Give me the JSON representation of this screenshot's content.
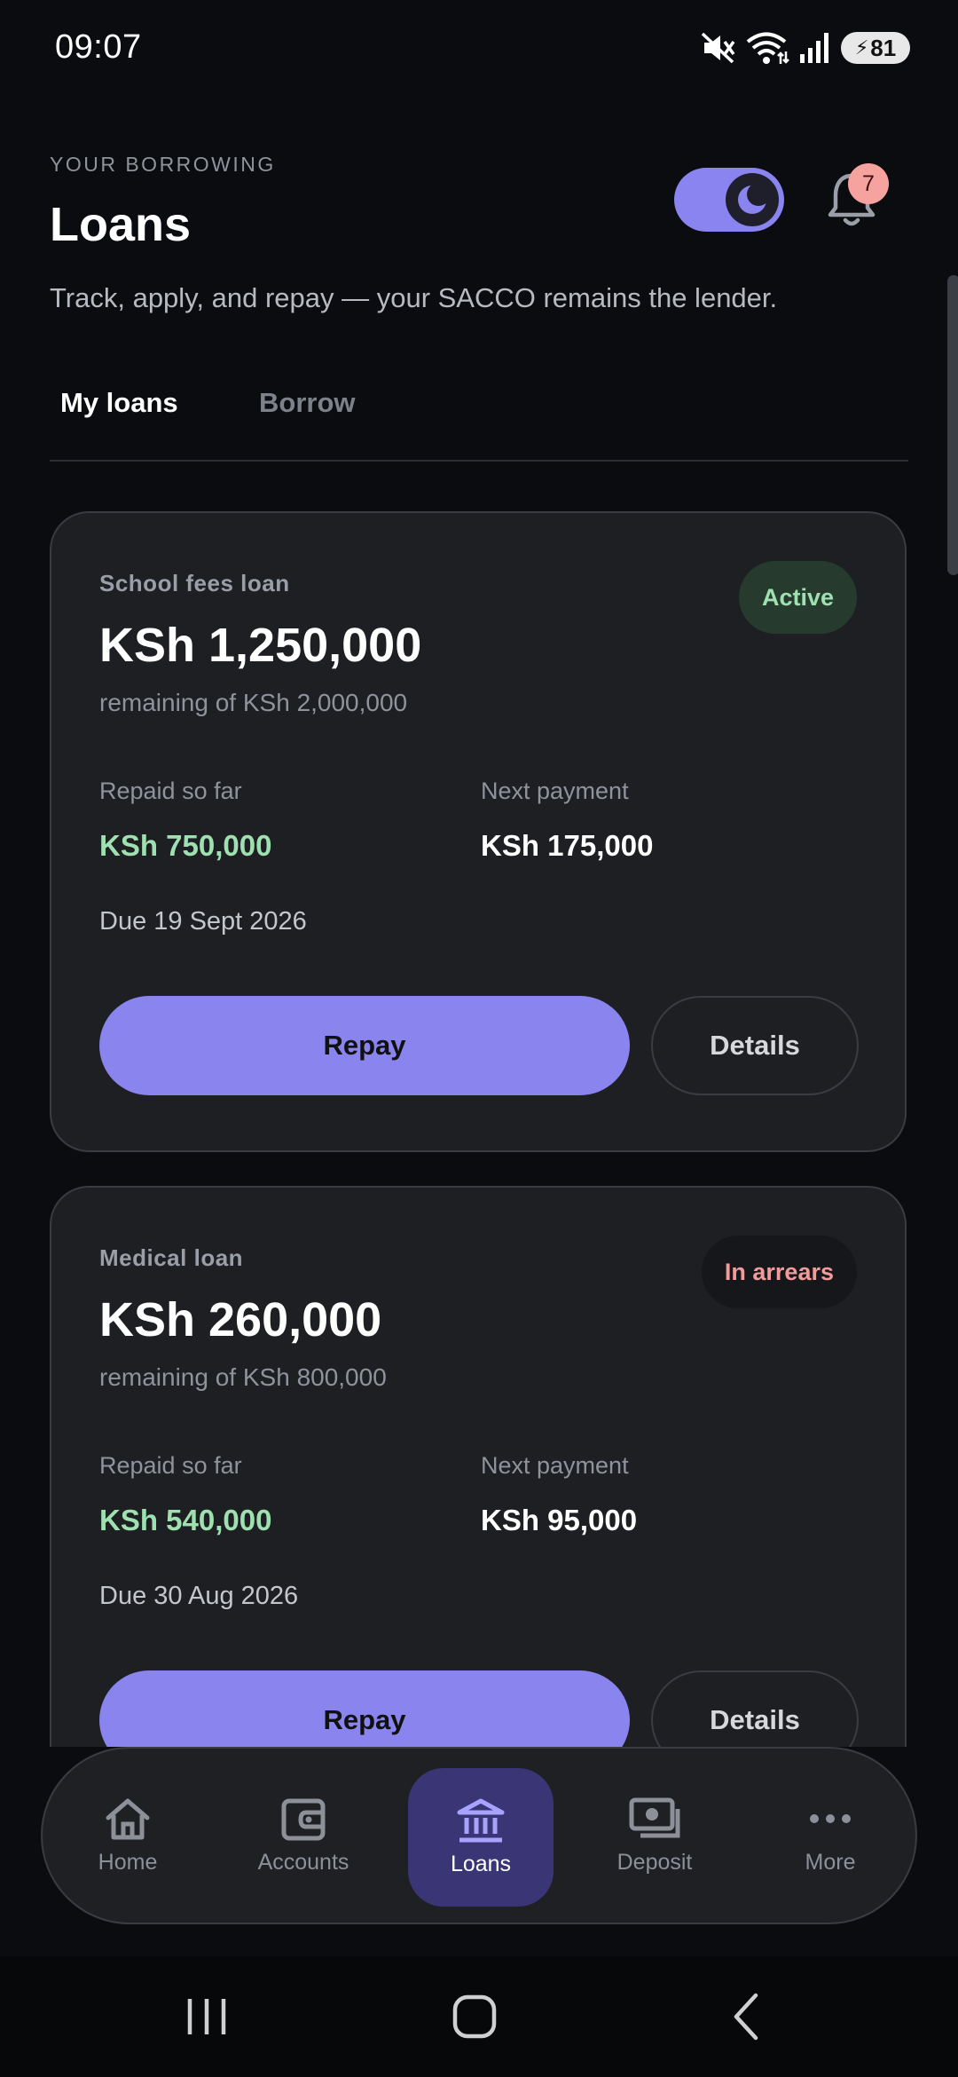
{
  "status_bar": {
    "time": "09:07",
    "battery": "81",
    "icons": [
      "mute-icon",
      "wifi-icon",
      "signal-icon",
      "battery-icon"
    ]
  },
  "header": {
    "eyebrow": "YOUR BORROWING",
    "title": "Loans",
    "subtitle": "Track, apply, and repay — your SACCO remains the lender.",
    "notification_count": "7",
    "theme": "dark"
  },
  "tabs": [
    {
      "label": "My loans",
      "active": true
    },
    {
      "label": "Borrow",
      "active": false
    }
  ],
  "loans": [
    {
      "type": "School fees loan",
      "status": "Active",
      "remaining": "KSh 1,250,000",
      "remaining_of": "remaining of KSh 2,000,000",
      "repaid_label": "Repaid so far",
      "repaid": "KSh 750,000",
      "next_label": "Next payment",
      "next_payment": "KSh 175,000",
      "due": "Due 19 Sept 2026",
      "repay_label": "Repay",
      "details_label": "Details"
    },
    {
      "type": "Medical loan",
      "status": "In arrears",
      "remaining": "KSh 260,000",
      "remaining_of": "remaining of KSh 800,000",
      "repaid_label": "Repaid so far",
      "repaid": "KSh 540,000",
      "next_label": "Next payment",
      "next_payment": "KSh 95,000",
      "due": "Due 30 Aug 2026",
      "repay_label": "Repay",
      "details_label": "Details"
    }
  ],
  "bottom_nav": [
    {
      "label": "Home",
      "icon": "home-icon",
      "active": false
    },
    {
      "label": "Accounts",
      "icon": "wallet-icon",
      "active": false
    },
    {
      "label": "Loans",
      "icon": "bank-icon",
      "active": true
    },
    {
      "label": "Deposit",
      "icon": "cash-icon",
      "active": false
    },
    {
      "label": "More",
      "icon": "more-icon",
      "active": false
    }
  ],
  "colors": {
    "accent": "#8a84ee",
    "positive": "#9fe0b0",
    "negative": "#f39b9a",
    "background": "#0b0c0f",
    "card": "#1e1f23"
  }
}
